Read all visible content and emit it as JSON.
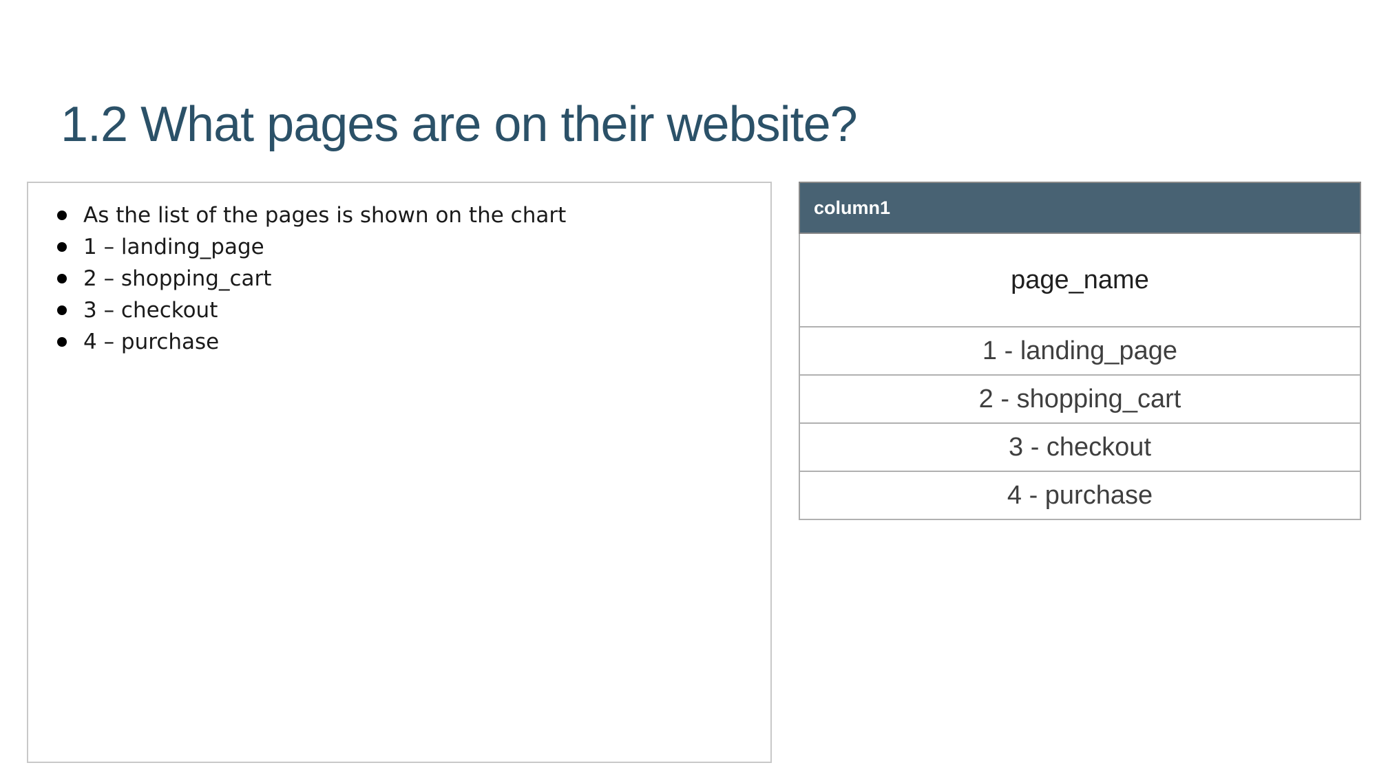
{
  "slide": {
    "title": "1.2 What pages are on their website?"
  },
  "bullets": [
    "As the list of the pages is shown on the chart",
    "1 – landing_page",
    "2 – shopping_cart",
    "3 – checkout",
    "4 – purchase"
  ],
  "table": {
    "column_header": "column1",
    "field_name": "page_name",
    "rows": [
      "1 - landing_page",
      "2 - shopping_cart",
      "3 - checkout",
      "4 - purchase"
    ]
  },
  "colors": {
    "title": "#2b5168",
    "table_header_bg": "#486273"
  }
}
